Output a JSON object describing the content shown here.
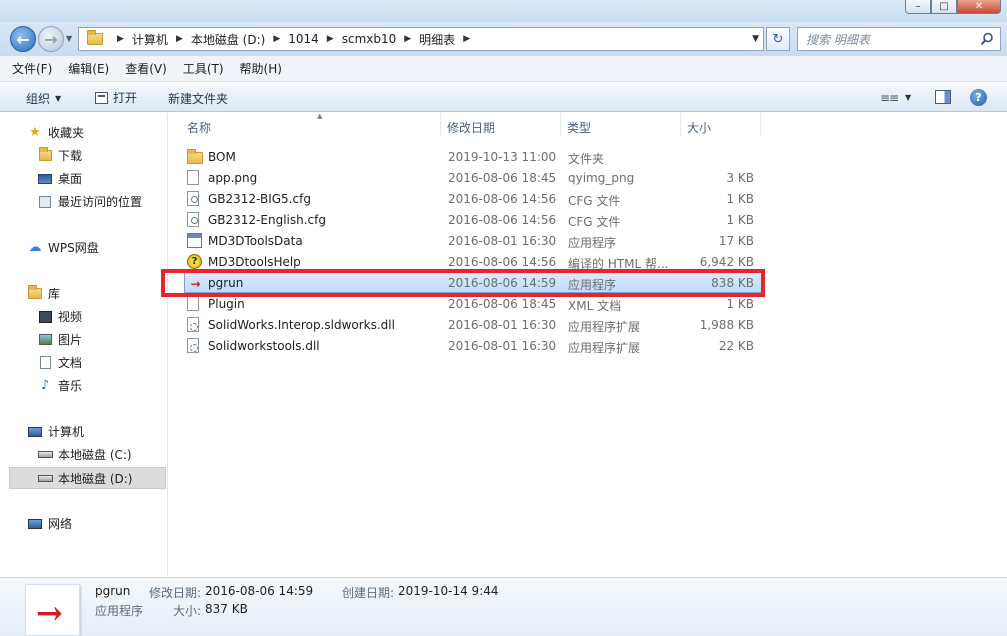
{
  "window": {
    "min_label": "–",
    "max_label": "□",
    "close_label": "✕"
  },
  "address": {
    "crumbs": [
      "计算机",
      "本地磁盘 (D:)",
      "1014",
      "scmxb10",
      "明细表"
    ],
    "search_placeholder": "搜索 明细表"
  },
  "menu": [
    "文件(F)",
    "编辑(E)",
    "查看(V)",
    "工具(T)",
    "帮助(H)"
  ],
  "toolbar": {
    "organize": "组织",
    "open": "打开",
    "new_folder": "新建文件夹",
    "help": "?"
  },
  "nav": {
    "favorites": "收藏夹",
    "downloads": "下载",
    "desktop": "桌面",
    "recent": "最近访问的位置",
    "wps": "WPS网盘",
    "libraries": "库",
    "videos": "视频",
    "pictures": "图片",
    "documents": "文档",
    "music": "音乐",
    "computer": "计算机",
    "drive_c": "本地磁盘 (C:)",
    "drive_d": "本地磁盘 (D:)",
    "network": "网络"
  },
  "columns": {
    "name": "名称",
    "date": "修改日期",
    "type": "类型",
    "size": "大小"
  },
  "files": [
    {
      "name": "BOM",
      "date": "2019-10-13 11:00",
      "type": "文件夹",
      "size": "",
      "icon": "folder-icon"
    },
    {
      "name": "app.png",
      "date": "2016-08-06 18:45",
      "type": "qyimg_png",
      "size": "3 KB",
      "icon": "image-file-icon"
    },
    {
      "name": "GB2312-BIG5.cfg",
      "date": "2016-08-06 14:56",
      "type": "CFG 文件",
      "size": "1 KB",
      "icon": "config-file-icon"
    },
    {
      "name": "GB2312-English.cfg",
      "date": "2016-08-06 14:56",
      "type": "CFG 文件",
      "size": "1 KB",
      "icon": "config-file-icon"
    },
    {
      "name": "MD3DToolsData",
      "date": "2016-08-01 16:30",
      "type": "应用程序",
      "size": "17 KB",
      "icon": "application-icon"
    },
    {
      "name": "MD3DtoolsHelp",
      "date": "2016-08-06 14:56",
      "type": "编译的 HTML 帮...",
      "size": "6,942 KB",
      "icon": "help-file-icon"
    },
    {
      "name": "pgrun",
      "date": "2016-08-06 14:59",
      "type": "应用程序",
      "size": "838 KB",
      "icon": "pgrun-app-icon"
    },
    {
      "name": "Plugin",
      "date": "2016-08-06 18:45",
      "type": "XML 文档",
      "size": "1 KB",
      "icon": "xml-file-icon"
    },
    {
      "name": "SolidWorks.Interop.sldworks.dll",
      "date": "2016-08-01 16:30",
      "type": "应用程序扩展",
      "size": "1,988 KB",
      "icon": "dll-file-icon"
    },
    {
      "name": "Solidworkstools.dll",
      "date": "2016-08-01 16:30",
      "type": "应用程序扩展",
      "size": "22 KB",
      "icon": "dll-file-icon"
    }
  ],
  "details": {
    "name": "pgrun",
    "kind": "应用程序",
    "modified_label": "修改日期:",
    "modified_value": "2016-08-06 14:59",
    "created_label": "创建日期:",
    "created_value": "2019-10-14 9:44",
    "size_label": "大小:",
    "size_value": "837 KB"
  },
  "colors": {
    "highlight_border": "#e8242f",
    "selection": "#c1dbfc",
    "accent": "#2d6cc0"
  }
}
